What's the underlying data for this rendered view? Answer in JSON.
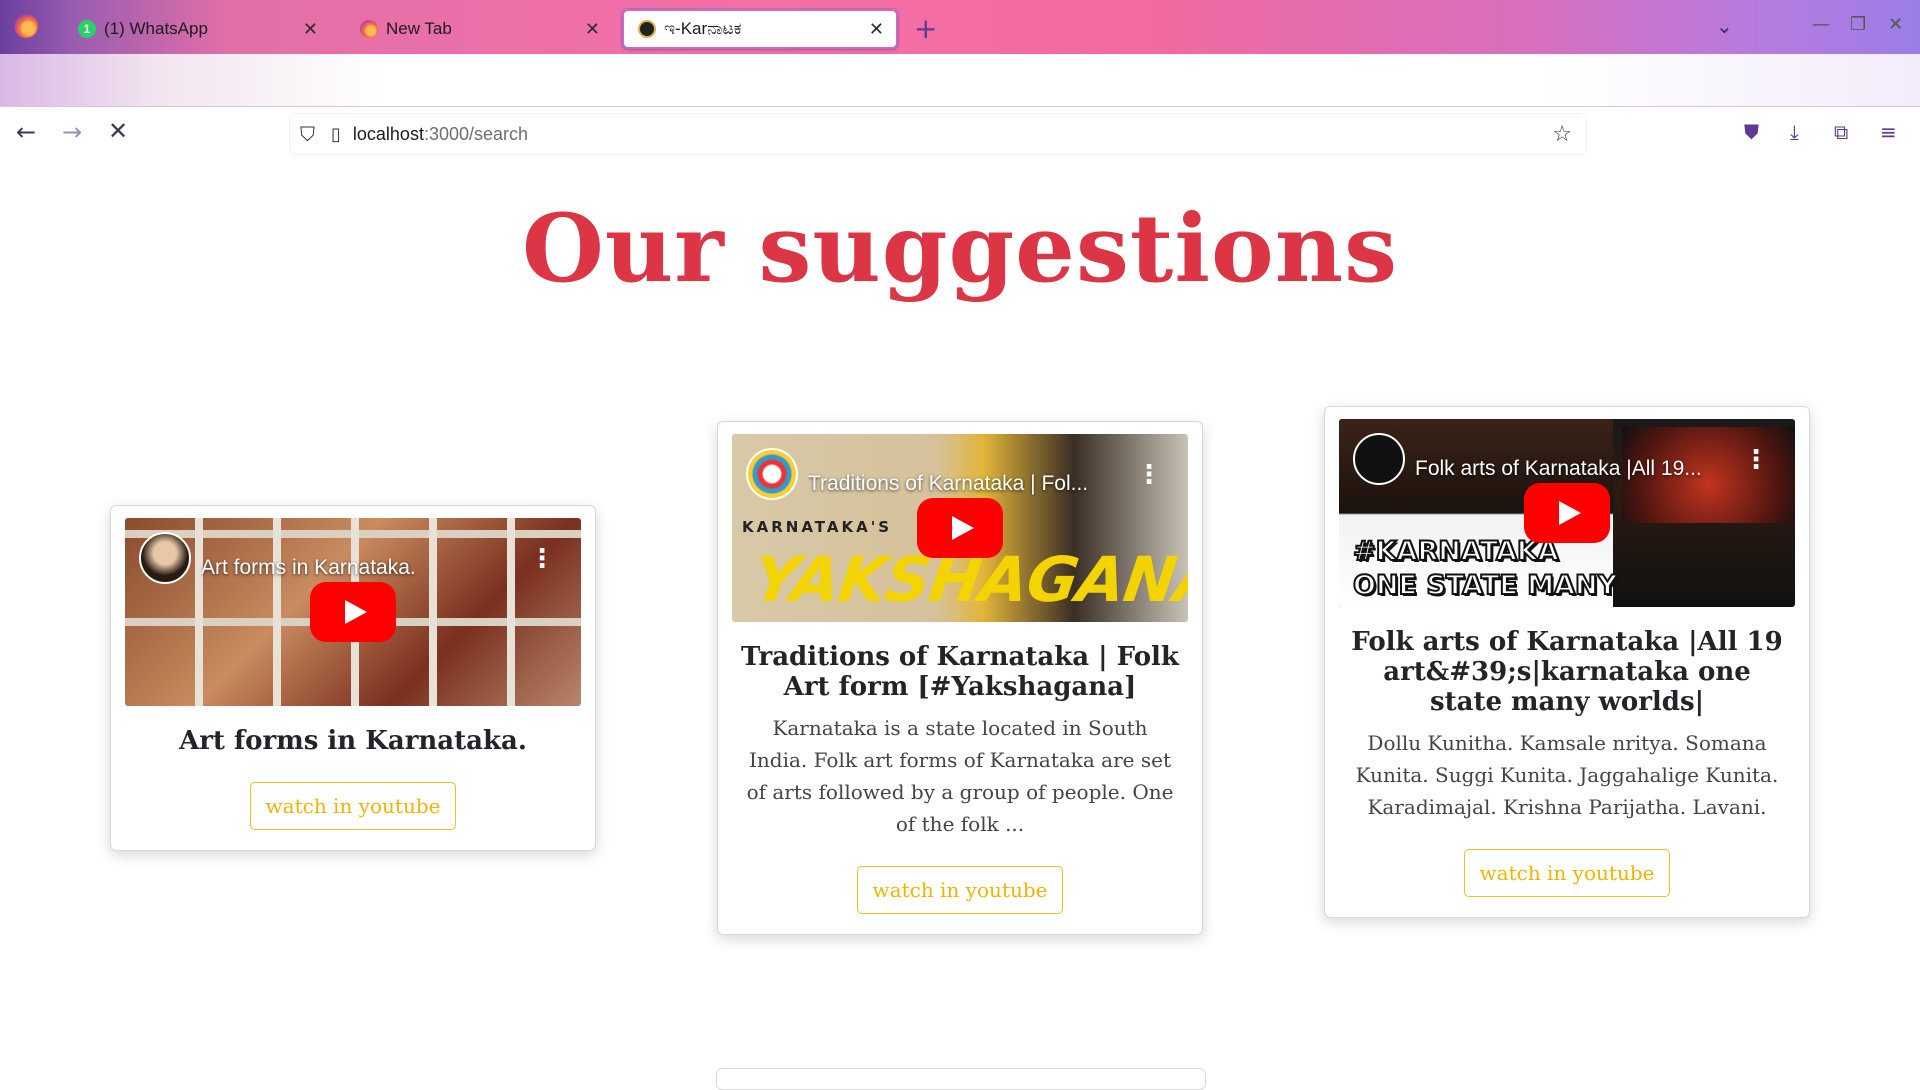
{
  "browser": {
    "tabs": [
      {
        "label": "(1) WhatsApp",
        "favicon": "whatsapp-icon",
        "badge": "1",
        "active": false
      },
      {
        "label": "New Tab",
        "favicon": "firefox-icon",
        "active": false
      },
      {
        "label": "ಇ-Karನಾಟಕ",
        "favicon": "site-icon",
        "active": true
      }
    ],
    "url": {
      "host": "localhost",
      "path": ":3000/search"
    },
    "accent": "#c06bd1"
  },
  "page": {
    "title": "Our suggestions",
    "title_color": "#dc3545",
    "button_color": "#f0b400"
  },
  "cards": [
    {
      "video_title": "Art forms in Karnataka.",
      "title": "Art forms in Karnataka.",
      "description": "",
      "button": "watch in youtube"
    },
    {
      "video_title": "Traditions of Karnataka | Fol...",
      "thumb_text_1": "KARNATAKA'S",
      "thumb_text_2": "YAKSHAGANA",
      "title": "Traditions of Karnataka | Folk Art form [#Yakshagana]",
      "description": "Karnataka is a state located in South India. Folk art forms of Karnataka are set of arts followed by a group of people. One of the folk ...",
      "button": "watch in youtube"
    },
    {
      "video_title": "Folk arts of Karnataka |All 19...",
      "thumb_text_1": "#KARNATAKA",
      "thumb_text_2": "ONE STATE MANY",
      "title": "Folk arts of Karnataka |All 19 art&#39;s|karnataka one state many worlds|",
      "description": "Dollu Kunitha. Kamsale nritya. Somana Kunita. Suggi Kunita. Jaggahalige Kunita. Karadimajal. Krishna Parijatha. Lavani.",
      "button": "watch in youtube"
    }
  ]
}
